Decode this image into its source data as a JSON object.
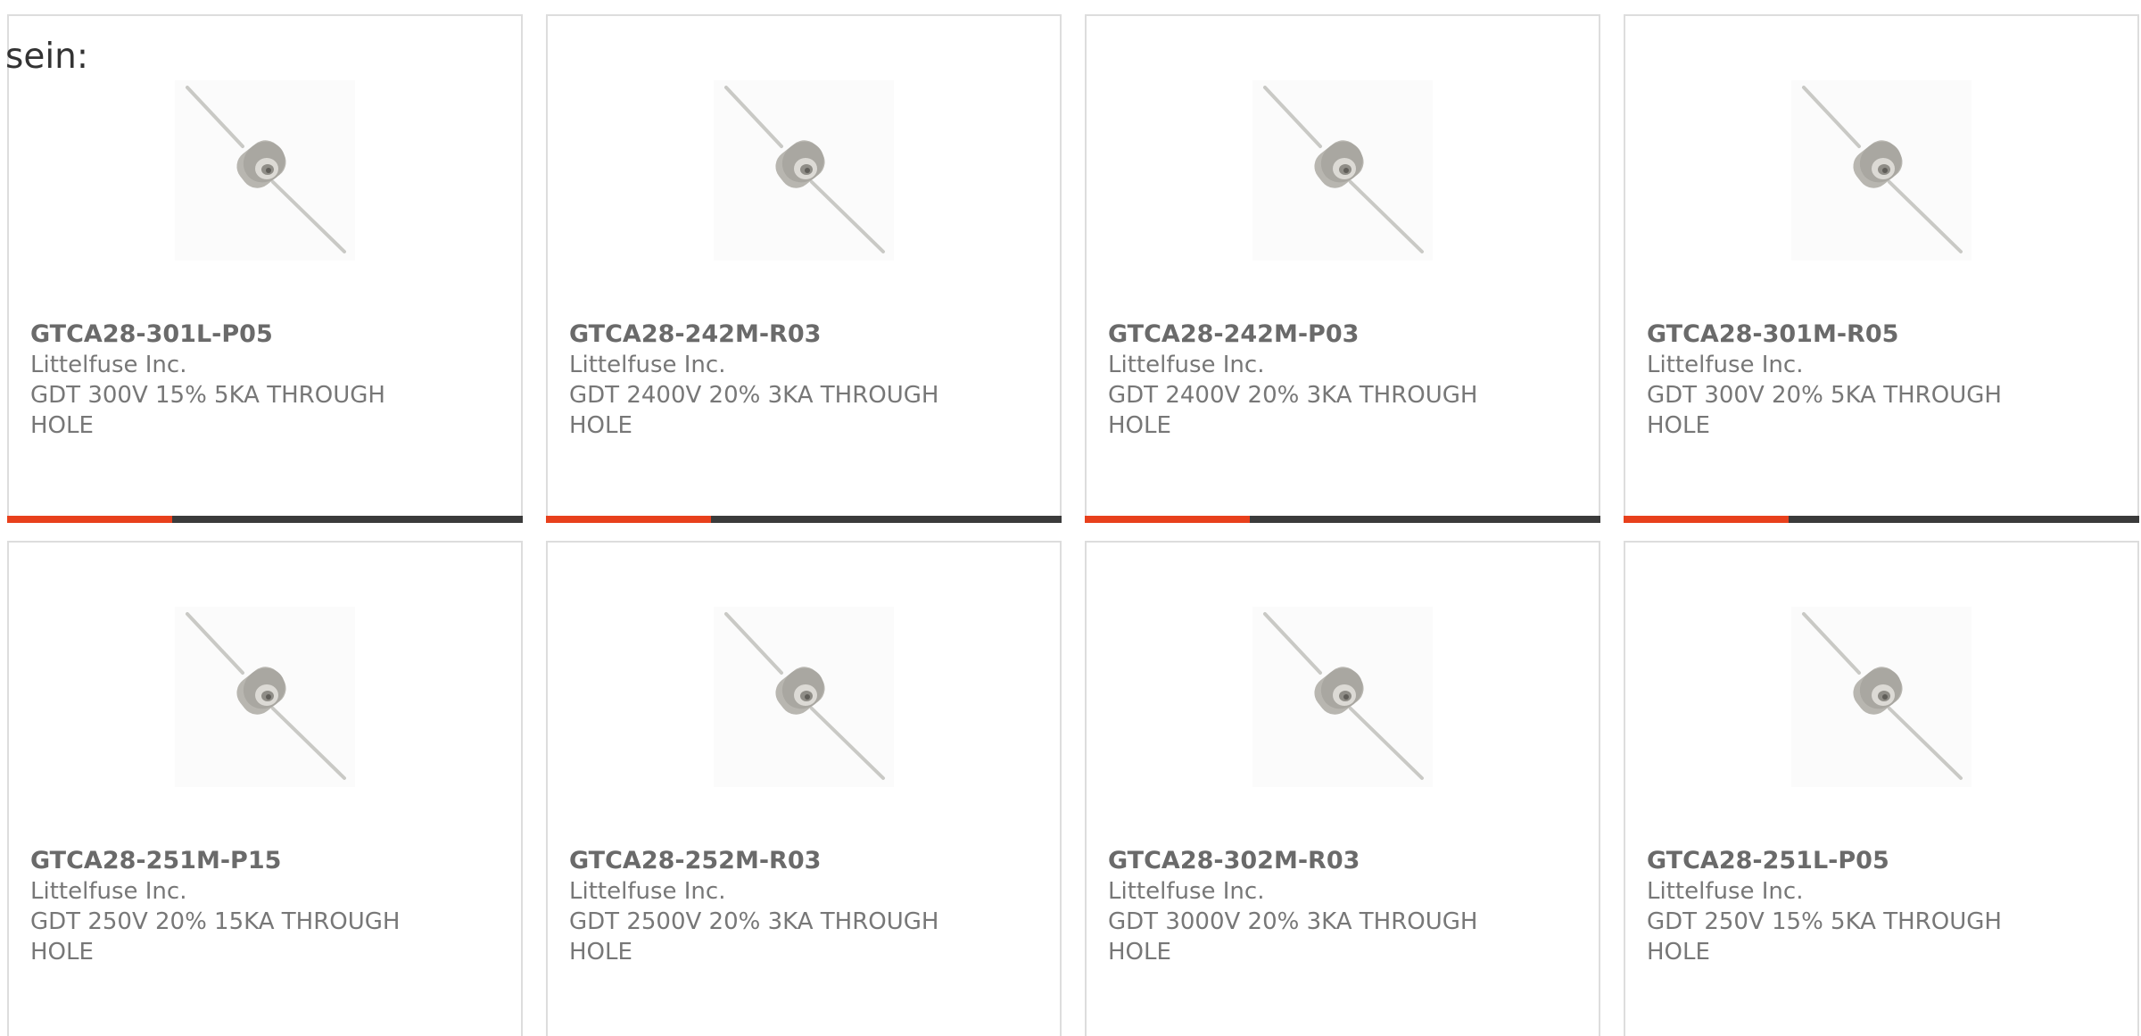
{
  "header": {
    "label": "sein:"
  },
  "colors": {
    "accent": "#e8401c",
    "track": "#3b3b3b"
  },
  "products": [
    {
      "part": "GTCA28-301L-P05",
      "manufacturer": "Littelfuse Inc.",
      "description": "GDT 300V 15% 5KA THROUGH HOLE",
      "progress": 0.32,
      "image_icon": "gas-discharge-tube-icon"
    },
    {
      "part": "GTCA28-242M-R03",
      "manufacturer": "Littelfuse Inc.",
      "description": "GDT 2400V 20% 3KA THROUGH HOLE",
      "progress": 0.32,
      "image_icon": "gas-discharge-tube-icon"
    },
    {
      "part": "GTCA28-242M-P03",
      "manufacturer": "Littelfuse Inc.",
      "description": "GDT 2400V 20% 3KA THROUGH HOLE",
      "progress": 0.32,
      "image_icon": "gas-discharge-tube-icon"
    },
    {
      "part": "GTCA28-301M-R05",
      "manufacturer": "Littelfuse Inc.",
      "description": "GDT 300V 20% 5KA THROUGH HOLE",
      "progress": 0.32,
      "image_icon": "gas-discharge-tube-icon"
    },
    {
      "part": "GTCA28-251M-P15",
      "manufacturer": "Littelfuse Inc.",
      "description": "GDT 250V 20% 15KA THROUGH HOLE",
      "image_icon": "gas-discharge-tube-icon"
    },
    {
      "part": "GTCA28-252M-R03",
      "manufacturer": "Littelfuse Inc.",
      "description": "GDT 2500V 20% 3KA THROUGH HOLE",
      "image_icon": "gas-discharge-tube-icon"
    },
    {
      "part": "GTCA28-302M-R03",
      "manufacturer": "Littelfuse Inc.",
      "description": "GDT 3000V 20% 3KA THROUGH HOLE",
      "image_icon": "gas-discharge-tube-icon"
    },
    {
      "part": "GTCA28-251L-P05",
      "manufacturer": "Littelfuse Inc.",
      "description": "GDT 250V 15% 5KA THROUGH HOLE",
      "image_icon": "gas-discharge-tube-icon"
    }
  ]
}
